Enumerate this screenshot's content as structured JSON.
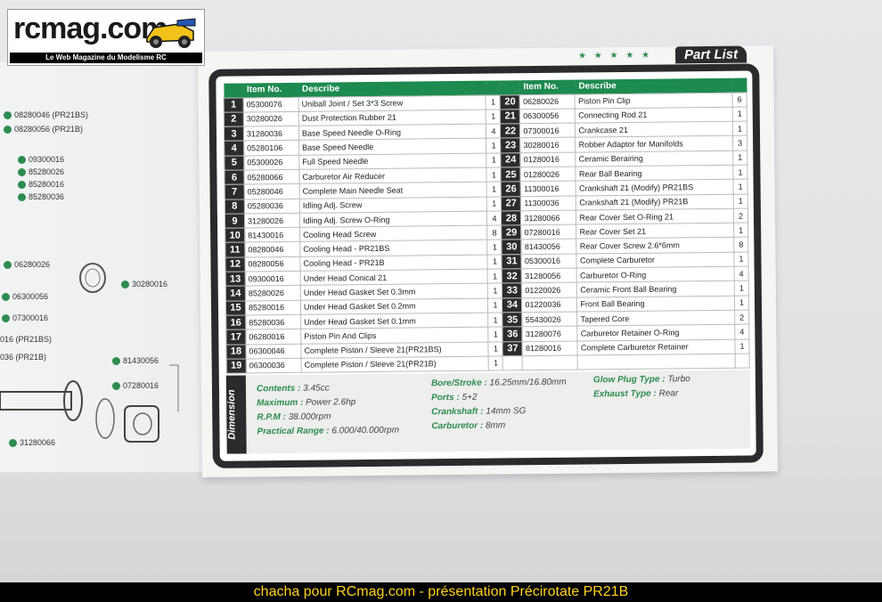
{
  "logo": {
    "text": "rcmag.com",
    "subtitle": "Le Web Magazine du Modelisme RC"
  },
  "header": {
    "title": "Part List",
    "stars": "★ ★ ★ ★ ★"
  },
  "columns": {
    "no": "",
    "item_no": "Item No.",
    "describe": "Describe"
  },
  "left_parts": [
    {
      "no": "1",
      "item": "05300076",
      "desc": "Uniball Joint / Set 3*3 Screw",
      "qty": "1"
    },
    {
      "no": "2",
      "item": "30280026",
      "desc": "Dust Protection Rubber 21",
      "qty": "1"
    },
    {
      "no": "3",
      "item": "31280036",
      "desc": "Base Speed Needle O-Ring",
      "qty": "4"
    },
    {
      "no": "4",
      "item": "05280106",
      "desc": "Base Speed Needle",
      "qty": "1"
    },
    {
      "no": "5",
      "item": "05300026",
      "desc": "Full Speed Needle",
      "qty": "1"
    },
    {
      "no": "6",
      "item": "05280066",
      "desc": "Carburetor Air Reducer",
      "qty": "1"
    },
    {
      "no": "7",
      "item": "05280046",
      "desc": "Complete Main Needle Seat",
      "qty": "1"
    },
    {
      "no": "8",
      "item": "05280036",
      "desc": "Idling Adj. Screw",
      "qty": "1"
    },
    {
      "no": "9",
      "item": "31280026",
      "desc": "Idling Adj. Screw  O-Ring",
      "qty": "4"
    },
    {
      "no": "10",
      "item": "81430016",
      "desc": "Cooling Head Screw",
      "qty": "8"
    },
    {
      "no": "11",
      "item": "08280046",
      "desc": "Cooling Head - PR21BS",
      "qty": "1"
    },
    {
      "no": "12",
      "item": "08280056",
      "desc": "Cooling Head - PR21B",
      "qty": "1"
    },
    {
      "no": "13",
      "item": "09300016",
      "desc": "Under Head Conical 21",
      "qty": "1"
    },
    {
      "no": "14",
      "item": "85280026",
      "desc": "Under Head Gasket Set 0.3mm",
      "qty": "1"
    },
    {
      "no": "15",
      "item": "85280016",
      "desc": "Under Head Gasket Set 0.2mm",
      "qty": "1"
    },
    {
      "no": "16",
      "item": "85280036",
      "desc": "Under Head Gasket Set 0.1mm",
      "qty": "1"
    },
    {
      "no": "17",
      "item": "06280016",
      "desc": "Piston Pin And Clips",
      "qty": "1"
    },
    {
      "no": "18",
      "item": "06300046",
      "desc": "Complete Piston / Sleeve 21(PR21BS)",
      "qty": "1"
    },
    {
      "no": "19",
      "item": "06300036",
      "desc": "Complete Piston / Sleeve 21(PR21B)",
      "qty": "1"
    }
  ],
  "right_parts": [
    {
      "no": "20",
      "item": "06280026",
      "desc": "Piston Pin Clip",
      "qty": "6"
    },
    {
      "no": "21",
      "item": "06300056",
      "desc": "Connecting Rod 21",
      "qty": "1"
    },
    {
      "no": "22",
      "item": "07300016",
      "desc": "Crankcase 21",
      "qty": "1"
    },
    {
      "no": "23",
      "item": "30280016",
      "desc": "Robber Adaptor for Manifolds",
      "qty": "3"
    },
    {
      "no": "24",
      "item": "01280016",
      "desc": "Ceramic Berairing",
      "qty": "1"
    },
    {
      "no": "25",
      "item": "01280026",
      "desc": "Rear Ball Bearing",
      "qty": "1"
    },
    {
      "no": "26",
      "item": "11300016",
      "desc": "Crankshaft 21 (Modify) PR21BS",
      "qty": "1"
    },
    {
      "no": "27",
      "item": "11300036",
      "desc": "Crankshaft 21 (Modify) PR21B",
      "qty": "1"
    },
    {
      "no": "28",
      "item": "31280066",
      "desc": "Rear Cover Set O-Ring 21",
      "qty": "2"
    },
    {
      "no": "29",
      "item": "07280016",
      "desc": "Rear Cover Set 21",
      "qty": "1"
    },
    {
      "no": "30",
      "item": "81430056",
      "desc": "Rear Cover Screw 2.6*6mm",
      "qty": "8"
    },
    {
      "no": "31",
      "item": "05300016",
      "desc": "Complete Carburetor",
      "qty": "1"
    },
    {
      "no": "32",
      "item": "31280056",
      "desc": "Carburetor O-Ring",
      "qty": "4"
    },
    {
      "no": "33",
      "item": "01220026",
      "desc": "Ceramic Front Ball Bearing",
      "qty": "1"
    },
    {
      "no": "34",
      "item": "01220036",
      "desc": "Front Ball Bearing",
      "qty": "1"
    },
    {
      "no": "35",
      "item": "55430026",
      "desc": "Tapered Core",
      "qty": "2"
    },
    {
      "no": "36",
      "item": "31280076",
      "desc": "Carburetor Retainer O-Ring",
      "qty": "4"
    },
    {
      "no": "37",
      "item": "81280016",
      "desc": "Complete Carburetor Retainer",
      "qty": "1"
    }
  ],
  "dimension": {
    "label": "Dimension",
    "contents": {
      "k": "Contents :",
      "v": "3.45cc"
    },
    "maximum": {
      "k": "Maximum :",
      "v": "Power 2.6hp"
    },
    "rpm": {
      "k": "R.P.M :",
      "v": "38.000rpm"
    },
    "range": {
      "k": "Practical Range :",
      "v": "6.000/40.000rpm"
    },
    "bore": {
      "k": "Bore/Stroke :",
      "v": "16.25mm/16.80mm"
    },
    "ports": {
      "k": "Ports :",
      "v": "5+2"
    },
    "crank": {
      "k": "Crankshaft :",
      "v": "14mm SG"
    },
    "carb": {
      "k": "Carburetor :",
      "v": "8mm"
    },
    "glow": {
      "k": "Glow Plug Type :",
      "v": "Turbo"
    },
    "exhaust": {
      "k": "Exhaust Type :",
      "v": "Rear"
    }
  },
  "left_page_refs": [
    "08280046 (PR21BS)",
    "08280056 (PR21B)",
    "09300016",
    "85280026",
    "85280016",
    "85280036",
    "06280026",
    "30280016",
    "06300056",
    "07300016",
    "016 (PR21BS)",
    "036 (PR21B)",
    "81430056",
    "07280016",
    "31280066"
  ],
  "caption": "chacha pour RCmag.com - présentation Précirotate PR21B"
}
